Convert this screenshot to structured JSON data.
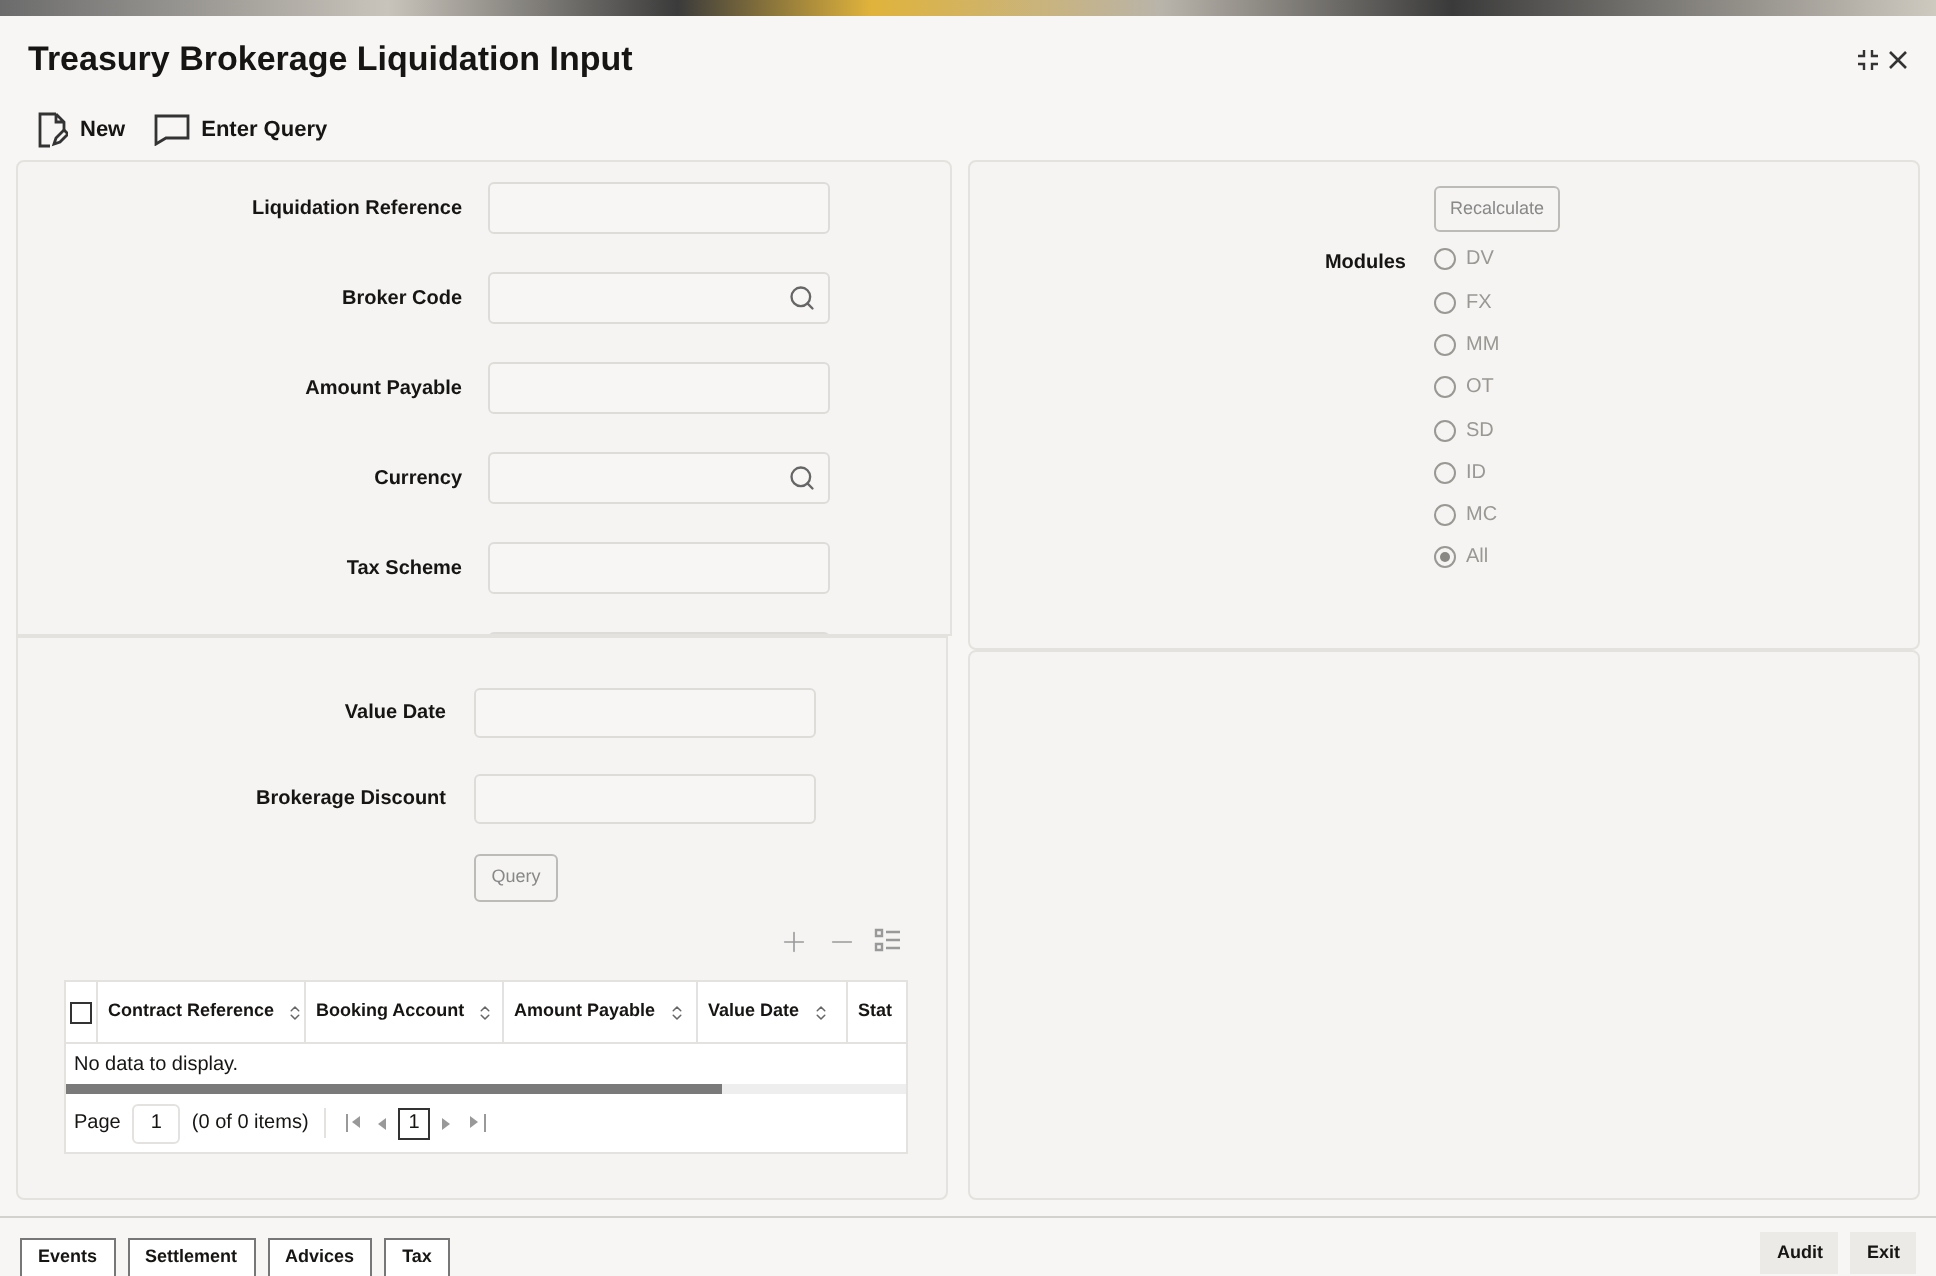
{
  "window": {
    "title": "Treasury Brokerage Liquidation Input"
  },
  "toolbar": [
    {
      "kind": "new",
      "label": "New"
    },
    {
      "kind": "query",
      "label": "Enter Query"
    }
  ],
  "main_fields": [
    {
      "label": "Liquidation Reference",
      "kind": "text"
    },
    {
      "label": "Broker Code",
      "kind": "search"
    },
    {
      "label": "Amount Payable",
      "kind": "text"
    },
    {
      "label": "Currency",
      "kind": "search"
    },
    {
      "label": "Tax Scheme",
      "kind": "text"
    }
  ],
  "recalculate_button": "Recalculate",
  "modules": {
    "label": "Modules",
    "options": [
      {
        "label": "DV",
        "selected": false
      },
      {
        "label": "FX",
        "selected": false
      },
      {
        "label": "MM",
        "selected": false
      },
      {
        "label": "OT",
        "selected": false
      },
      {
        "label": "SD",
        "selected": false
      },
      {
        "label": "ID",
        "selected": false
      },
      {
        "label": "MC",
        "selected": false
      },
      {
        "label": "All",
        "selected": true
      }
    ]
  },
  "query_fields": [
    {
      "label": "Value Date"
    },
    {
      "label": "Brokerage Discount"
    }
  ],
  "query_button": "Query",
  "table": {
    "columns": [
      "Contract Reference",
      "Booking Account",
      "Amount Payable",
      "Value Date",
      "Stat"
    ],
    "empty_text": "No data to display.",
    "select_all_checked": false
  },
  "pagination": {
    "page_label": "Page",
    "page": "1",
    "items": "(0 of 0 items)",
    "current": "1"
  },
  "footer_left": [
    "Events",
    "Settlement",
    "Advices",
    "Tax"
  ],
  "footer_right": [
    "Audit",
    "Exit"
  ]
}
